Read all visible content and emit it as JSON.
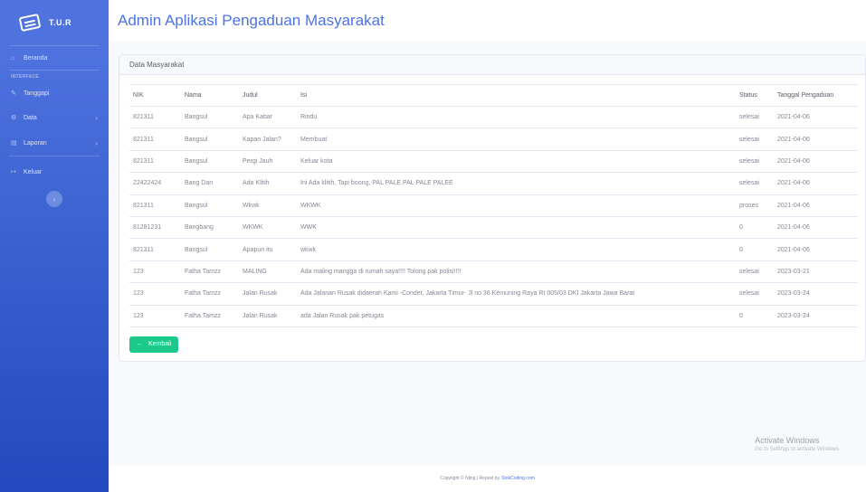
{
  "sidebar": {
    "brand": "T.U.R",
    "heading": "INTERFACE",
    "items": [
      {
        "label": "Beranda",
        "icon": "home-icon"
      },
      {
        "label": "Tanggapi",
        "icon": "edit-icon"
      },
      {
        "label": "Data",
        "icon": "gear-icon"
      },
      {
        "label": "Laporan",
        "icon": "folder-icon"
      },
      {
        "label": "Keluar",
        "icon": "logout-icon"
      }
    ],
    "toggle_glyph": "‹"
  },
  "header": {
    "title": "Admin Aplikasi Pengaduan Masyarakat"
  },
  "card": {
    "title": "Data Masyarakat",
    "columns": [
      "NIK",
      "Nama",
      "Judul",
      "Isi",
      "Status",
      "Tanggal Pengaduan"
    ],
    "rows": [
      [
        "821311",
        "Bangsul",
        "Apa Kabar",
        "Rindu",
        "selesai",
        "2021-04-06"
      ],
      [
        "821311",
        "Bangsul",
        "Kapan Jalan?",
        "Membuat",
        "selesai",
        "2021-04-06"
      ],
      [
        "821311",
        "Bangsul",
        "Pergi Jauh",
        "Keluar kota",
        "selesai",
        "2021-04-06"
      ],
      [
        "22422424",
        "Bang Dan",
        "Ada Klitih",
        "Ini Ada klitih, Tapi boong, PAL PALE PAL PALE PALEE",
        "selesai",
        "2021-04-06"
      ],
      [
        "821311",
        "Bangsul",
        "Wkwk",
        "WKWK",
        "proses",
        "2021-04-06"
      ],
      [
        "81281231",
        "Bangbang",
        "WKWK",
        "WWK",
        "0",
        "2021-04-06"
      ],
      [
        "821311",
        "Bangsul",
        "Apapun itu",
        "wkwk",
        "0",
        "2021-04-06"
      ],
      [
        "123",
        "Fatha Tamzz",
        "MALING",
        "Ada maling mangga di rumah saya!!!! Tolong pak polisi!!!!",
        "selesai",
        "2023-03-21"
      ],
      [
        "123",
        "Fatha Tamzz",
        "Jalan Rusak",
        "Ada Jalanan Rusak didaerah Kami -Condet, Jakarta Timur- Jl no 36 Kemuning Raya Rt 005/03 DKI Jakarta Jawa Barat",
        "selesai",
        "2023-03-24"
      ],
      [
        "123",
        "Fatha Tamzz",
        "Jalan Rusak",
        "ada Jalan Rusak pak petugas",
        "0",
        "2023-03-24"
      ]
    ],
    "back_button": "Kembali"
  },
  "watermark": {
    "title": "Activate Windows",
    "subtitle": "Go to Settings to activate Windows."
  },
  "footer": {
    "text": "Copyright © Njing | Repost by",
    "link": "StokCoding.com"
  },
  "colors": {
    "sidebar": "#4e73df",
    "accent": "#4e73df",
    "success": "#1cc88a"
  }
}
